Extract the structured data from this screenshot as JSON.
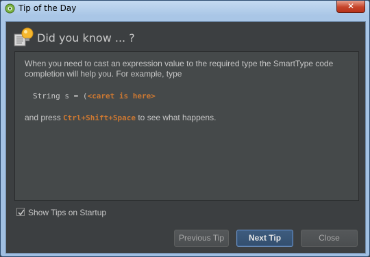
{
  "window": {
    "title": "Tip of the Day",
    "close_label": "✕"
  },
  "header": {
    "title": "Did you know ... ?"
  },
  "tip": {
    "intro": "When you need to cast an expression value to the required type the SmartType code completion will help you. For example, type",
    "code_prefix": "String s = (",
    "code_caret": "<caret is here>",
    "outro_before": "and press ",
    "shortcut": "Ctrl+Shift+Space",
    "outro_after": " to see what happens."
  },
  "options": {
    "show_on_startup_label": "Show Tips on Startup",
    "show_on_startup_checked": true
  },
  "buttons": {
    "previous": "Previous Tip",
    "next": "Next Tip",
    "close": "Close"
  },
  "colors": {
    "accent_code": "#cc7832",
    "background": "#3c3f41"
  }
}
